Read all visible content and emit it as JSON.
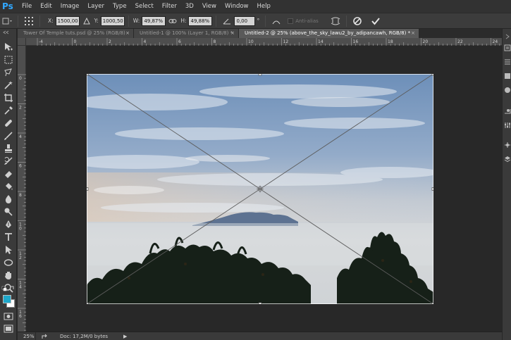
{
  "app": {
    "logo": "Ps"
  },
  "menu": [
    "File",
    "Edit",
    "Image",
    "Layer",
    "Type",
    "Select",
    "Filter",
    "3D",
    "View",
    "Window",
    "Help"
  ],
  "options": {
    "x_label": "X:",
    "x_value": "1500,00 px",
    "y_label": "Y:",
    "y_value": "1000,50 px",
    "w_label": "W:",
    "w_value": "49,87%",
    "h_label": "H:",
    "h_value": "49,88%",
    "angle_value": "0,00",
    "angle_unit": "°",
    "antialias_label": "Anti-alias"
  },
  "tabs": [
    {
      "label": "Tower Of Temple tuts.psd @ 25% (RGB/8)",
      "close": "×",
      "active": false
    },
    {
      "label": "Untitled-1 @ 100% (Layer 1, RGB/8) *",
      "close": "×",
      "active": false
    },
    {
      "label": "Untitled-2 @ 25% (above_the_sky_lawu2_by_adipancawh, RGB/8) *",
      "close": "×",
      "active": true
    }
  ],
  "rulers": {
    "top": [
      "-4",
      "0",
      "2",
      "4",
      "6",
      "8",
      "10",
      "12",
      "14",
      "16",
      "18",
      "20",
      "22",
      "24"
    ],
    "left": [
      "0",
      "2",
      "4",
      "6",
      "8",
      "10",
      "12",
      "14",
      "16"
    ]
  },
  "status": {
    "zoom": "25%",
    "doc": "Doc: 17,2M/0 bytes",
    "arrow": "▶"
  },
  "colors": {
    "foreground": "#1ea7c9",
    "background": "#ffffff",
    "accent": "#31a8ff"
  }
}
